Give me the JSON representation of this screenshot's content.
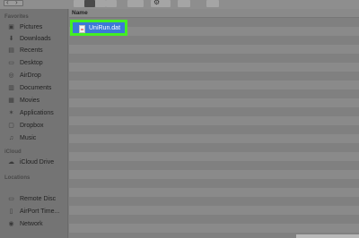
{
  "sidebar": {
    "favorites_title": "Favorites",
    "favorites": [
      {
        "label": "Pictures",
        "icon": "pictures-icon"
      },
      {
        "label": "Downloads",
        "icon": "downloads-icon"
      },
      {
        "label": "Recents",
        "icon": "recents-icon"
      },
      {
        "label": "Desktop",
        "icon": "desktop-icon"
      },
      {
        "label": "AirDrop",
        "icon": "airdrop-icon"
      },
      {
        "label": "Documents",
        "icon": "documents-icon"
      },
      {
        "label": "Movies",
        "icon": "movies-icon"
      },
      {
        "label": "Applications",
        "icon": "applications-icon"
      },
      {
        "label": "Dropbox",
        "icon": "dropbox-icon"
      },
      {
        "label": "Music",
        "icon": "music-icon"
      }
    ],
    "icloud_title": "iCloud",
    "icloud": [
      {
        "label": "iCloud Drive",
        "icon": "cloud-icon"
      }
    ],
    "locations_title": "Locations",
    "locations": [
      {
        "label": "Remote Disc",
        "icon": "disc-icon"
      },
      {
        "label": "AirPort Time...",
        "icon": "airport-icon"
      },
      {
        "label": "Network",
        "icon": "network-icon"
      }
    ]
  },
  "content": {
    "column_header": "Name",
    "files": [
      {
        "name": "UniRun.dat",
        "icon": "document-icon",
        "selected": true
      }
    ]
  },
  "colors": {
    "selection": "#3c78d8",
    "highlight": "#44ee22"
  }
}
